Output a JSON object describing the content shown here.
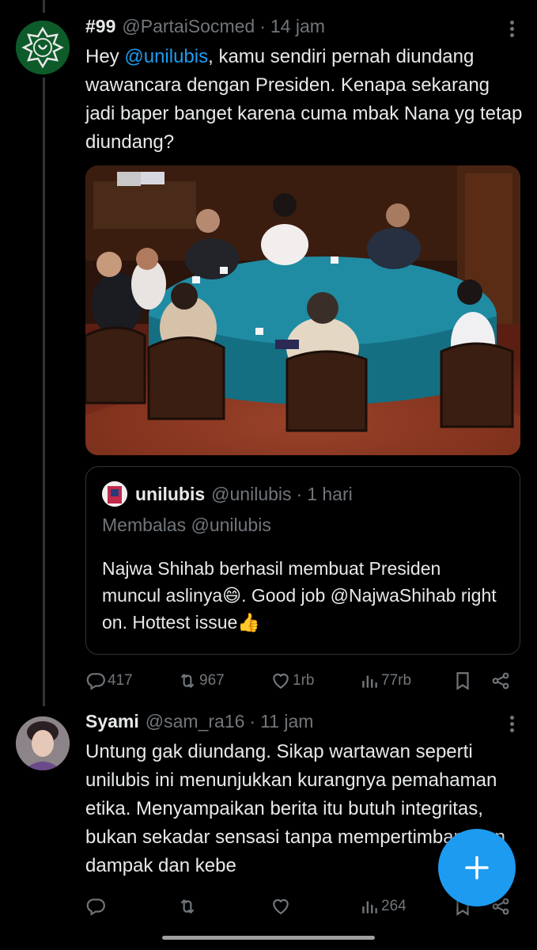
{
  "tweet1": {
    "name": "#99",
    "handle": "@PartaiSocmed",
    "time": "14 jam",
    "text_prefix": "Hey ",
    "mention": "@unilubis",
    "text_rest": ", kamu sendiri pernah diundang wawancara dengan Presiden. Kenapa sekarang jadi baper banget karena cuma mbak Nana yg tetap diundang?",
    "quote": {
      "name": "unilubis",
      "handle": "@unilubis",
      "time": "1 hari",
      "reply_to": "Membalas @unilubis",
      "text": "Najwa Shihab berhasil membuat Presiden muncul aslinya😄. Good job @NajwaShihab right on. Hottest issue👍"
    },
    "actions": {
      "replies": "417",
      "reposts": "967",
      "likes": "1rb",
      "views": "77rb"
    }
  },
  "tweet2": {
    "name": "Syami",
    "handle": "@sam_ra16",
    "time": "11 jam",
    "text": "Untung gak diundang. Sikap wartawan seperti unilubis ini menunjukkan kurangnya pemahaman etika. Menyampaikan berita itu butuh integritas, bukan sekadar sensasi tanpa mempertimbangkan dampak dan kebe",
    "actions": {
      "replies": "",
      "reposts": "",
      "likes": "",
      "views": "264"
    }
  },
  "separator_dot": "·",
  "colors": {
    "background": "#000000",
    "text": "#e7e9ea",
    "muted": "#71767b",
    "accent": "#1d9bf0"
  },
  "icons": [
    "reply-icon",
    "repost-icon",
    "like-icon",
    "views-icon",
    "bookmark-icon",
    "share-icon",
    "more-icon",
    "compose-plus-icon"
  ]
}
